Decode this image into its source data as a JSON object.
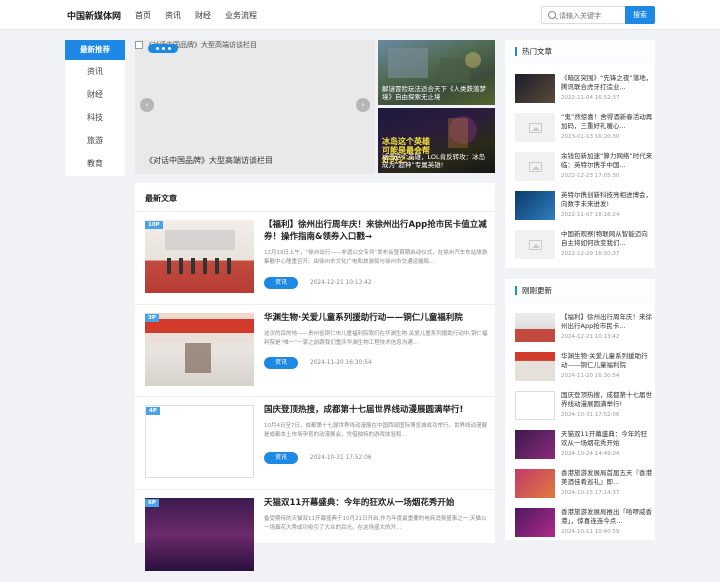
{
  "header": {
    "logo": "中国新媒体网",
    "nav": [
      "首页",
      "资讯",
      "财经",
      "业务流程"
    ],
    "search_placeholder": "请输入关键字",
    "search_button": "搜索"
  },
  "left_nav": {
    "active": "最新推荐",
    "items": [
      "资讯",
      "财经",
      "科技",
      "旅游",
      "教育"
    ]
  },
  "carousel": {
    "broken_alt": "《对话中国品牌》大型高端访谈栏目",
    "caption": "《对话中国品牌》大型高端访谈栏目",
    "prev": "‹",
    "next": "›"
  },
  "side_thumbs": [
    {
      "text": "解谜冒险玩法适合天下《人类跌落梦境》自由探索无止境"
    },
    {
      "headline": "冰岛这个英雄\n可能是最会帮\n好的之一",
      "text": "冰岛这个英雄，LOL肯反转攻：冰岛成为“超神”专属英雄!"
    }
  ],
  "news": {
    "heading": "最新文章",
    "articles": [
      {
        "badge": "10P",
        "title": "【福利】徐州出行周年庆！来徐州出行App抢市民卡值立减券！操作指南&领券入口戳→",
        "summary": "12月19日上午，“徐州出行——非遗公交专列”发布会暨首期启动仪式，在徐州汽车东站旅游集散中心隆重召开。由徐州市文化广电和旅游局与徐州市交通运输局...",
        "tag": "资讯",
        "time": "2024-12-21 10:13:42"
      },
      {
        "badge": "3P",
        "title": "华渊生物·关爱儿童系列援助行动——铜仁儿童福利院",
        "summary": "这次的目的地——贵州省铜仁市儿童福利院我们在华渊生物·关爱儿童系列援助行动中,铜仁福利院是“唯一”一家之前跟我们重庆华渊生物工程技术信息沟通...",
        "tag": "资讯",
        "time": "2024-11-20 16:30:54"
      },
      {
        "badge": "4P",
        "title": "国庆登顶热搜，成都第十七届世界线动漫展圆满举行!",
        "summary": "10月4日至7日，成都第十七届世界线动漫展在中国西部国际博览城成功举行。世界线动漫展是成都本土市场孕育的动漫展会，凭借独特的游戏体验和...",
        "tag": "资讯",
        "time": "2024-10-31 17:52:06"
      },
      {
        "badge": "6P",
        "title": "天猫双11开幕盛典：今年的狂欢从一场烟花秀开始",
        "summary": "备受期待的天猫双11开幕盛典于10月21日开启,作为年度最重要的电商消费盛事之一,天猫以一场烟花大秀成功吸引了大众的目光。在这场盛大的开...",
        "tag": "资讯",
        "time": "2024-10-24 14:49:04"
      }
    ]
  },
  "hot": {
    "heading": "热门文章",
    "items": [
      {
        "title": "《暗区突围》“先锋之夜”落地，腾讯联合虎牙打造业...",
        "date": "2022-11-04 16:52:37"
      },
      {
        "title": "“鬼”然惊喜！舍得酒新春活动再加码，三重好礼暖心...",
        "date": "2023-01-13 16:20:30"
      },
      {
        "title": "余钱包新加速“算力网络”时代来临：英特尔携手中国...",
        "date": "2022-12-23 17:05:30"
      },
      {
        "title": "英特尔携创新科技亮相进博会，向数字未来进发!",
        "date": "2022-11-07 18:16:24"
      },
      {
        "title": "中国新观察|物联网从智能迈向自主将如何改变我们...",
        "date": "2022-12-29 16:50:37"
      }
    ]
  },
  "latest": {
    "heading": "刚刚更新",
    "items": [
      {
        "title": "【福利】徐州出行周年庆！来徐州出行App抢市民卡...",
        "date": "2024-12-21 10:13:42"
      },
      {
        "title": "华渊生物·关爱儿童系列援助行动——铜仁儿童福利院",
        "date": "2024-11-20 16:30:54"
      },
      {
        "title": "国庆登顶热搜，成都第十七届世界线动漫展圆满举行!",
        "date": "2024-10-31 17:52:06"
      },
      {
        "title": "天猫双11开幕盛典：今年的狂欢从一场烟花秀开始",
        "date": "2024-10-24 14:49:04"
      },
      {
        "title": "香港旅游发展局首届五天『香港美酒佳肴巡礼』即...",
        "date": "2024-10-15 17:14:37"
      },
      {
        "title": "香港旅游发展局推出「哈啰威香港」，惊喜连连今点...",
        "date": "2024-10-11 10:40:59"
      }
    ]
  },
  "colors": {
    "accent": "#1e88e5",
    "badge": "#4aa3e8",
    "page_bg": "#f0f2f5"
  }
}
